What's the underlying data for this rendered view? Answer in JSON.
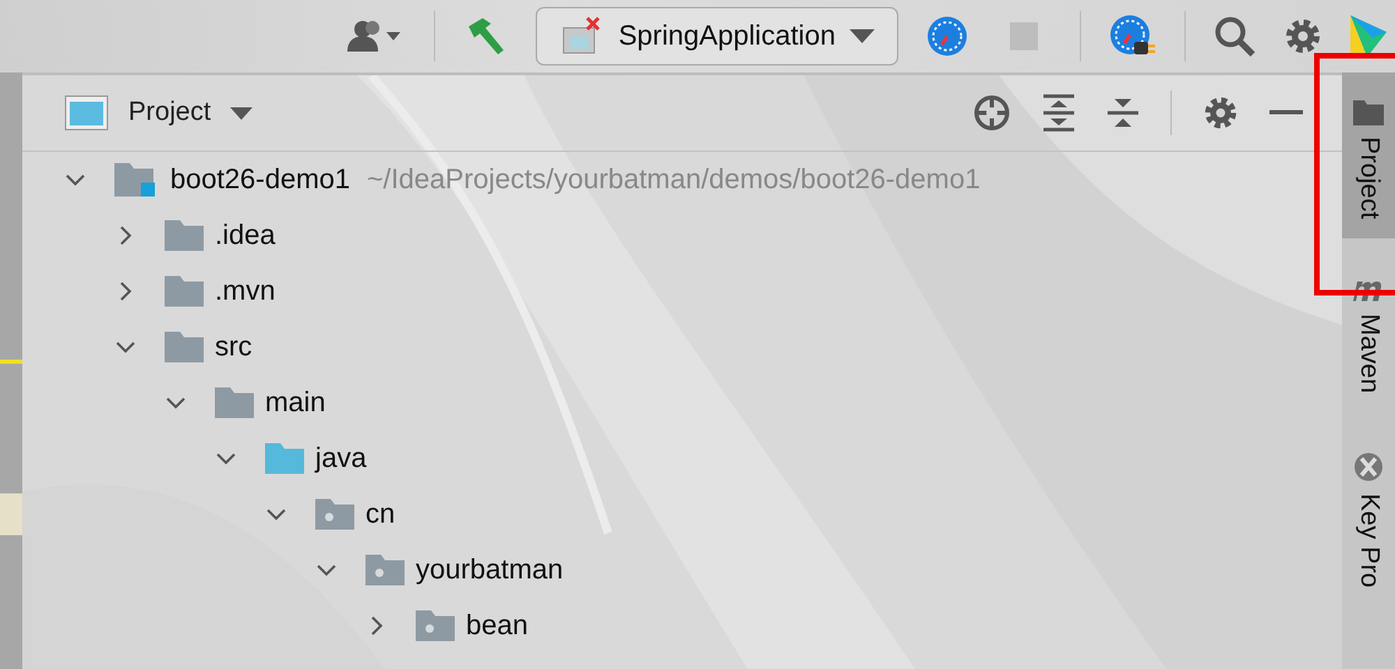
{
  "toolbar": {
    "run_config": {
      "label": "SpringApplication"
    },
    "stop": {
      "disabled": true
    }
  },
  "panel": {
    "title": "Project"
  },
  "tree": [
    {
      "name": "boot26-demo1",
      "path": "~/IdeaProjects/yourbatman/demos/boot26-demo1",
      "kind": "module",
      "expanded": true,
      "children": [
        {
          "name": ".idea",
          "kind": "folder",
          "expanded": false
        },
        {
          "name": ".mvn",
          "kind": "folder",
          "expanded": false
        },
        {
          "name": "src",
          "kind": "folder",
          "expanded": true,
          "children": [
            {
              "name": "main",
              "kind": "folder",
              "expanded": true,
              "children": [
                {
                  "name": "java",
                  "kind": "source",
                  "expanded": true,
                  "children": [
                    {
                      "name": "cn",
                      "kind": "package",
                      "expanded": true,
                      "children": [
                        {
                          "name": "yourbatman",
                          "kind": "package",
                          "expanded": true,
                          "children": [
                            {
                              "name": "bean",
                              "kind": "package",
                              "expanded": false
                            }
                          ]
                        }
                      ]
                    }
                  ]
                }
              ]
            }
          ]
        }
      ]
    }
  ],
  "side_tabs": [
    {
      "label": "Project",
      "kind": "folder",
      "selected": true
    },
    {
      "label": "Maven",
      "kind": "maven",
      "selected": false
    },
    {
      "label": "Key Pro",
      "kind": "key",
      "selected": false
    }
  ]
}
